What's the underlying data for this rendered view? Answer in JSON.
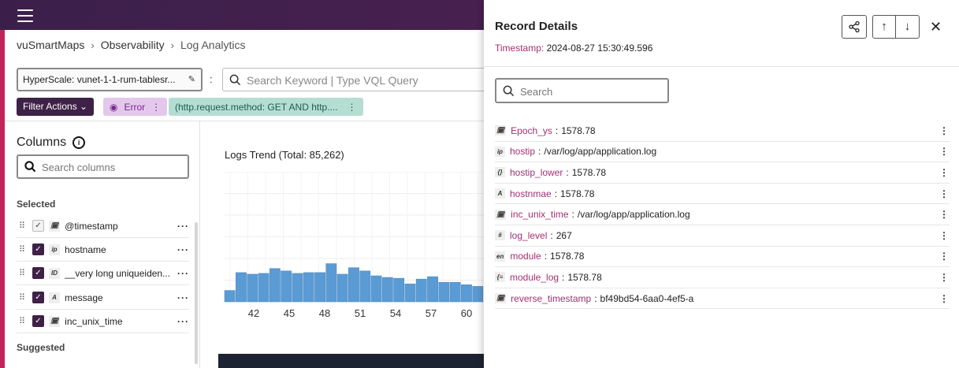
{
  "breadcrumb": [
    "vuSmartMaps",
    "Observability",
    "Log Analytics"
  ],
  "source": {
    "label": "HyperScale: vunet-1-1-rum-tablesr..."
  },
  "query": {
    "placeholder": "Search Keyword | Type VQL Query"
  },
  "filters": {
    "actions_label": "Filter Actions",
    "chips": [
      {
        "label": "Error",
        "color": "#e3c8eb"
      },
      {
        "label": "(http.request.method: GET AND http....",
        "color": "#b5ded3"
      }
    ]
  },
  "columns_panel": {
    "title": "Columns",
    "search_placeholder": "Search columns",
    "selected_label": "Selected",
    "suggested_label": "Suggested",
    "selected": [
      {
        "type": "date-icon",
        "type_text": "🗓",
        "name": "@timestamp",
        "checked_style": "light"
      },
      {
        "type": "ip-icon",
        "type_text": "ip",
        "name": "hostname",
        "checked_style": "dark"
      },
      {
        "type": "id-icon",
        "type_text": "ID",
        "name": "__very long uniqueiden...",
        "checked_style": "dark"
      },
      {
        "type": "text-icon",
        "type_text": "A",
        "name": "message",
        "checked_style": "dark"
      },
      {
        "type": "date-icon",
        "type_text": "🗓",
        "name": "inc_unix_time",
        "checked_style": "dark"
      }
    ]
  },
  "logs_trend": {
    "title": "Logs Trend (Total: 85,262)"
  },
  "chart_data": {
    "type": "bar",
    "title": "Logs Trend (Total: 85,262)",
    "x_ticks": [
      "42",
      "45",
      "48",
      "51",
      "54",
      "57",
      "60"
    ],
    "values": [
      14,
      36,
      34,
      35,
      41,
      38,
      35,
      36,
      36,
      47,
      34,
      42,
      38,
      32,
      30,
      29,
      22,
      28,
      31,
      24,
      24,
      21,
      19
    ],
    "ylim": [
      0,
      160
    ],
    "grid": true,
    "color": "#5b9bd5"
  },
  "record_details": {
    "title": "Record Details",
    "timestamp_label": "Timestamp:",
    "timestamp_value": "2024-08-27 15:30:49.596",
    "search_placeholder": "Search",
    "fields": [
      {
        "type": "date-icon",
        "type_text": "🗓",
        "name": "Epoch_ys",
        "value": "1578.78"
      },
      {
        "type": "ip-icon",
        "type_text": "ip",
        "name": "hostip",
        "value": "/var/log/app/application.log"
      },
      {
        "type": "json-icon",
        "type_text": "{}",
        "name": "hostip_lower",
        "value": "1578.78"
      },
      {
        "type": "text-icon",
        "type_text": "A",
        "name": "hostnmae",
        "value": "1578.78"
      },
      {
        "type": "date-icon",
        "type_text": "🗓",
        "name": "inc_unix_time",
        "value": "/var/log/app/application.log"
      },
      {
        "type": "number-icon",
        "type_text": "#",
        "name": "log_level",
        "value": "267"
      },
      {
        "type": "lang-icon",
        "type_text": "en",
        "name": "module",
        "value": "1578.78"
      },
      {
        "type": "list-icon",
        "type_text": "{≡",
        "name": "module_log",
        "value": "1578.78"
      },
      {
        "type": "date-icon",
        "type_text": "🗓",
        "name": "reverse_timestamp",
        "value": "bf49bd54-6aa0-4ef5-a"
      }
    ]
  },
  "colors": {
    "brand": "#3e2147",
    "accent": "#a23072",
    "bar": "#5b9bd5"
  }
}
